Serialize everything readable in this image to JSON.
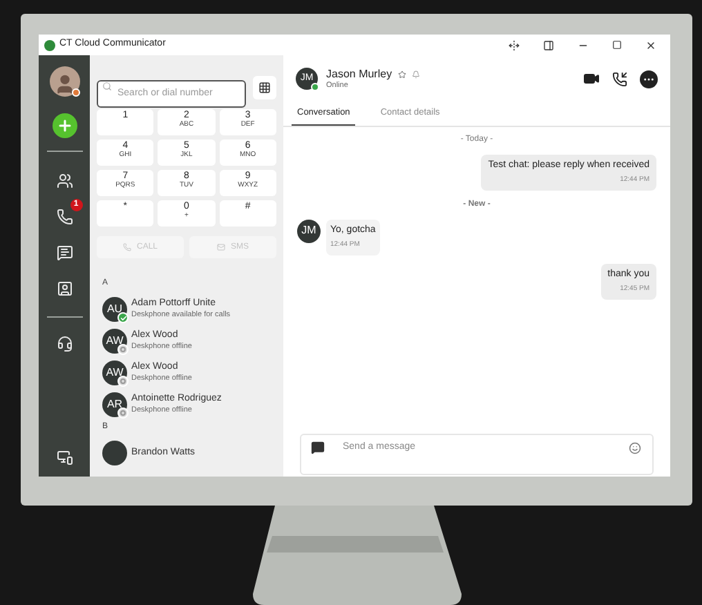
{
  "window": {
    "title": "CT Cloud Communicator"
  },
  "sidebar": {
    "items": [
      {
        "kind": "contacts"
      },
      {
        "kind": "calls",
        "badge": "1"
      },
      {
        "kind": "chat"
      },
      {
        "kind": "video"
      }
    ],
    "lower_items": [
      {
        "kind": "support"
      }
    ]
  },
  "dialer": {
    "search": {
      "placeholder": "Search or dial number"
    },
    "keys": [
      {
        "digit": "1"
      },
      {
        "digit": "2",
        "letters": "ABC"
      },
      {
        "digit": "3",
        "letters": "DEF"
      },
      {
        "digit": "4",
        "letters": "GHI"
      },
      {
        "digit": "5",
        "letters": "JKL"
      },
      {
        "digit": "6",
        "letters": "MNO"
      },
      {
        "digit": "7",
        "letters": "PQRS"
      },
      {
        "digit": "8",
        "letters": "TUV"
      },
      {
        "digit": "9",
        "letters": "WXYZ"
      },
      {
        "digit": "*"
      },
      {
        "digit": "0",
        "letters": "+"
      },
      {
        "digit": "#"
      }
    ],
    "actions": [
      {
        "kind": "call",
        "label": "CALL",
        "disabled": true
      },
      {
        "kind": "sms",
        "label": "SMS",
        "disabled": true
      }
    ]
  },
  "contacts": {
    "groups": [
      {
        "letter": "A",
        "contacts": [
          {
            "initials": "AU",
            "name": "Adam Pottorff Unite",
            "status": "Deskphone available for calls",
            "available": true
          },
          {
            "initials": "AW",
            "name": "Alex Wood",
            "status": "Deskphone offline",
            "available": false
          },
          {
            "initials": "AW",
            "name": "Alex Wood",
            "status": "Deskphone offline",
            "available": false
          },
          {
            "initials": "AR",
            "name": "Antoinette Rodriguez",
            "status": "Deskphone offline",
            "available": false
          }
        ]
      },
      {
        "letter": "B",
        "contacts": [
          {
            "name": "Brandon Watts"
          }
        ]
      }
    ]
  },
  "conversation": {
    "contact": {
      "initials": "JM",
      "name": "Jason Murley",
      "presence": "Online"
    },
    "tabs": [
      {
        "label": "Conversation",
        "selected": true
      },
      {
        "label": "Contact details",
        "selected": false
      }
    ],
    "messages": [
      {
        "kind": "divider",
        "text": "- Today -",
        "bold": false
      },
      {
        "kind": "sent",
        "text": "Test chat: please reply when received",
        "time": "12:44 PM"
      },
      {
        "kind": "divider",
        "text": "- New -",
        "bold": true
      },
      {
        "kind": "received",
        "initials": "JM",
        "text": "Yo, gotcha",
        "time": "12:44 PM"
      },
      {
        "kind": "sent",
        "text": "thank you",
        "time": "12:45 PM"
      }
    ],
    "composer": {
      "placeholder": "Send a message"
    }
  }
}
